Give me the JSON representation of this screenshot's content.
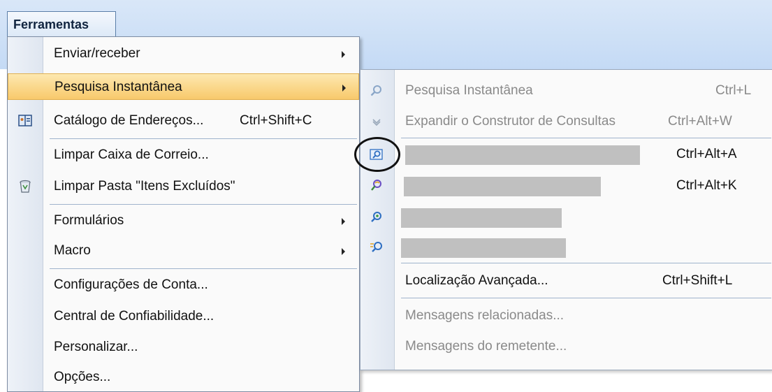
{
  "menubar": {
    "tab_label": "Ferramentas"
  },
  "menu": {
    "items": [
      {
        "label": "Enviar/receber",
        "shortcut": "",
        "submenu": true
      },
      {
        "label": "Pesquisa Instantânea",
        "shortcut": "",
        "submenu": true,
        "selected": true
      },
      {
        "label": "Catálogo de Endereços...",
        "shortcut": "Ctrl+Shift+C",
        "icon": "address-book-icon"
      },
      {
        "label": "Limpar Caixa de Correio...",
        "shortcut": ""
      },
      {
        "label": "Limpar Pasta \"Itens Excluídos\"",
        "shortcut": "",
        "icon": "trash-icon"
      },
      {
        "label": "Formulários",
        "shortcut": "",
        "submenu": true
      },
      {
        "label": "Macro",
        "shortcut": "",
        "submenu": true
      },
      {
        "label": "Configurações de Conta...",
        "shortcut": ""
      },
      {
        "label": "Central de Confiabilidade...",
        "shortcut": ""
      },
      {
        "label": "Personalizar...",
        "shortcut": ""
      },
      {
        "label": "Opções...",
        "shortcut": ""
      }
    ]
  },
  "submenu": {
    "items": [
      {
        "label": "Pesquisa Instantânea",
        "shortcut": "Ctrl+L",
        "disabled": true,
        "icon": "search-icon"
      },
      {
        "label": "Expandir o Construtor de Consultas",
        "shortcut": "Ctrl+Alt+W",
        "disabled": true,
        "icon": "chevron-down-icon"
      },
      {
        "label": "",
        "shortcut": "Ctrl+Alt+A",
        "redacted": true,
        "icon": "search-folder-icon"
      },
      {
        "label": "",
        "shortcut": "Ctrl+Alt+K",
        "redacted": true,
        "icon": "search-color-icon"
      },
      {
        "label": "",
        "shortcut": "",
        "redacted": true,
        "icon": "search-options-icon"
      },
      {
        "label": "",
        "shortcut": "",
        "redacted": true,
        "icon": "search-advanced-icon"
      },
      {
        "label": "Localização Avançada...",
        "shortcut": "Ctrl+Shift+L"
      },
      {
        "label": "Mensagens relacionadas...",
        "shortcut": "",
        "disabled": true
      },
      {
        "label": "Mensagens do remetente...",
        "shortcut": "",
        "disabled": true
      }
    ]
  },
  "colors": {
    "highlight": "#f8c96b",
    "menubar": "#c4daf5",
    "accent_icon": "#2f6fc2"
  }
}
